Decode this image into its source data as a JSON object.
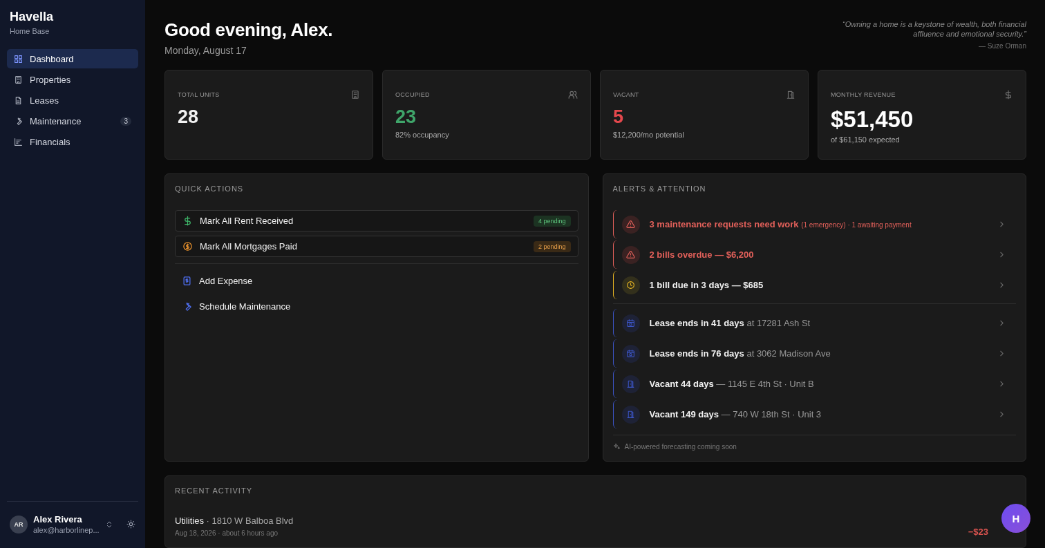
{
  "sidebar": {
    "brand": "Havella",
    "subtitle": "Home Base",
    "items": [
      {
        "label": "Dashboard",
        "selected": true
      },
      {
        "label": "Properties",
        "selected": false
      },
      {
        "label": "Leases",
        "selected": false
      },
      {
        "label": "Maintenance",
        "selected": false,
        "badge": "3"
      },
      {
        "label": "Financials",
        "selected": false
      }
    ],
    "user": {
      "initials": "AR",
      "name": "Alex Rivera",
      "email": "alex@harborlinep..."
    }
  },
  "header": {
    "greeting": "Good evening, Alex.",
    "date": "Monday, August 17",
    "quote": "“Owning a home is a keystone of wealth, both financial affluence and emotional security.”",
    "quote_author": "— Suze Orman"
  },
  "stats": [
    {
      "label": "TOTAL UNITS",
      "value": "28",
      "kind": "neutral"
    },
    {
      "label": "OCCUPIED",
      "value": "23",
      "note": "82% occupancy",
      "kind": "positive"
    },
    {
      "label": "VACANT",
      "value": "5",
      "note": "$12,200/mo potential",
      "kind": "negative"
    },
    {
      "label": "MONTHLY REVENUE",
      "value": "$51,450",
      "note": "of $61,150 expected",
      "kind": "money"
    }
  ],
  "quick_actions": {
    "title": "QUICK ACTIONS",
    "items": [
      {
        "label": "Mark All Rent Received",
        "badge": "4 pending",
        "kind": "bulk"
      },
      {
        "label": "Mark All Mortgages Paid",
        "badge": "2 pending",
        "kind": "bulk"
      },
      {
        "label": "Add Expense",
        "kind": "link"
      },
      {
        "label": "Schedule Maintenance",
        "kind": "link"
      }
    ]
  },
  "alerts": {
    "title": "ALERTS & ATTENTION",
    "groups": [
      [
        {
          "kind": "maintenance",
          "title": "3 maintenance requests need work",
          "detail": "(1 emergency) · 1 awaiting payment"
        },
        {
          "kind": "overdue",
          "title": "2 bills overdue — $6,200"
        },
        {
          "kind": "due",
          "title": "1 bill due in 3 days — $685"
        }
      ],
      [
        {
          "kind": "lease",
          "title": "Lease ends in 41 days",
          "detail": "at 17281 Ash St"
        },
        {
          "kind": "lease",
          "title": "Lease ends in 76 days",
          "detail": "at 3062 Madison Ave"
        },
        {
          "kind": "vacant",
          "title": "Vacant 44 days",
          "detail": "— 1145 E 4th St · Unit B"
        },
        {
          "kind": "vacant",
          "title": "Vacant 149 days",
          "detail": "— 740 W 18th St · Unit 3"
        }
      ]
    ],
    "footer": "AI-powered forecasting coming soon"
  },
  "recent_activity": {
    "title": "RECENT ACTIVITY",
    "items": [
      {
        "title": "Utilities",
        "place": "· 1810 W Balboa Blvd",
        "meta": "Aug 18, 2026 · about 6 hours ago",
        "amount": "−$23"
      }
    ]
  },
  "assistant_button": {
    "label": "H"
  }
}
